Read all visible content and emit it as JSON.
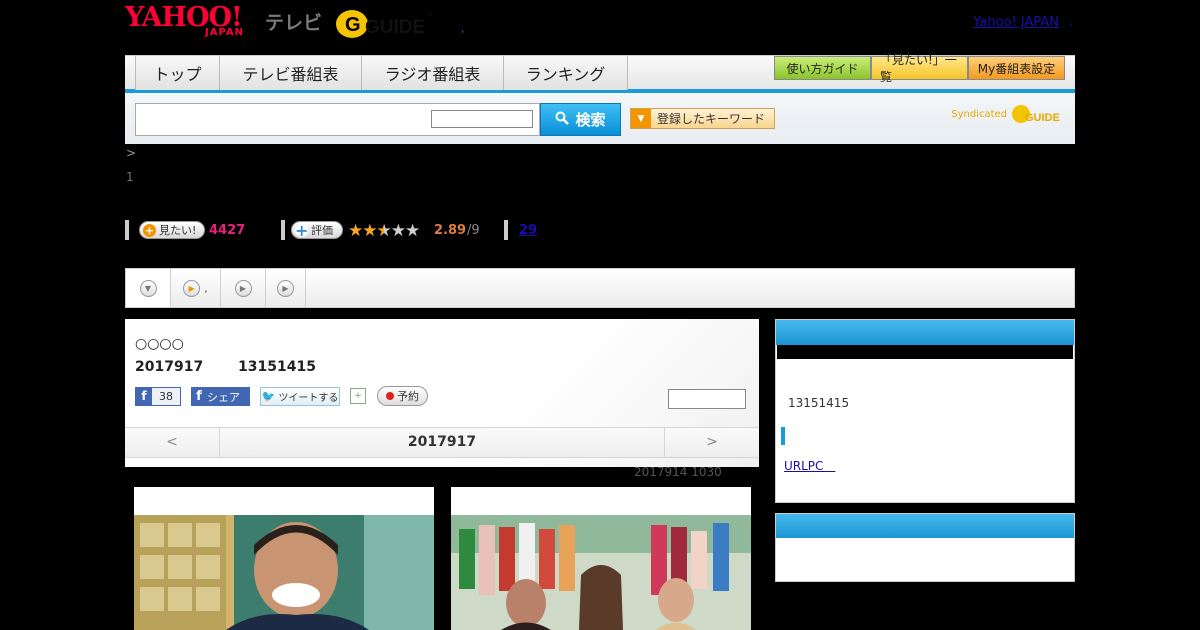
{
  "header": {
    "logo_yahoo": "YAHOO!",
    "logo_japan": "JAPAN",
    "logo_tv": "テレビ",
    "logo_gguide": "G GUIDE",
    "logo_dot": ",",
    "yahoo_japan_link": "Yahoo! JAPAN",
    "link_dot": ","
  },
  "nav": {
    "tabs": [
      {
        "label": "トップ"
      },
      {
        "label": "テレビ番組表"
      },
      {
        "label": "ラジオ番組表"
      },
      {
        "label": "ランキング"
      }
    ],
    "guide_button": "使い方ガイド",
    "mitai_list_button": "「見たい!」一覧",
    "my_schedule_button": "My番組表設定"
  },
  "search": {
    "input_value": "",
    "select_value": "",
    "search_button": "検索",
    "keyword_button": "登録したキーワード",
    "syndicated_label": "Syndicated",
    "syndicated_logo": "GUIDE"
  },
  "breadcrumb": {
    "arrow": ">",
    "page_number": "1"
  },
  "stats": {
    "want_label": "見たい!",
    "want_count": "4427",
    "rate_label": "評価",
    "stars": 2.5,
    "rating": "2.89",
    "rating_den": "/9",
    "comments": "29"
  },
  "media_tabs": [
    {
      "icon": "down-arrow-icon",
      "label": ""
    },
    {
      "icon": "play-icon",
      "label": ","
    },
    {
      "icon": "play-icon",
      "label": ""
    },
    {
      "icon": "play-icon",
      "label": ""
    }
  ],
  "program": {
    "title": "○○○○",
    "date": "2017917",
    "time": "13151415",
    "fb_like_count": "38",
    "fb_share": "シェア",
    "tweet": "ツイートする",
    "reserve": "予約",
    "select_value": ""
  },
  "day_nav": {
    "prev": "<",
    "date": "2017917",
    "next": ">"
  },
  "updated": "2017914  1030",
  "sidebar": {
    "time": "13151415",
    "link": "URLPC　"
  },
  "colors": {
    "accent_blue": "#1c9bd9",
    "pink": "#e8217c",
    "brand_red": "#ff0033"
  }
}
